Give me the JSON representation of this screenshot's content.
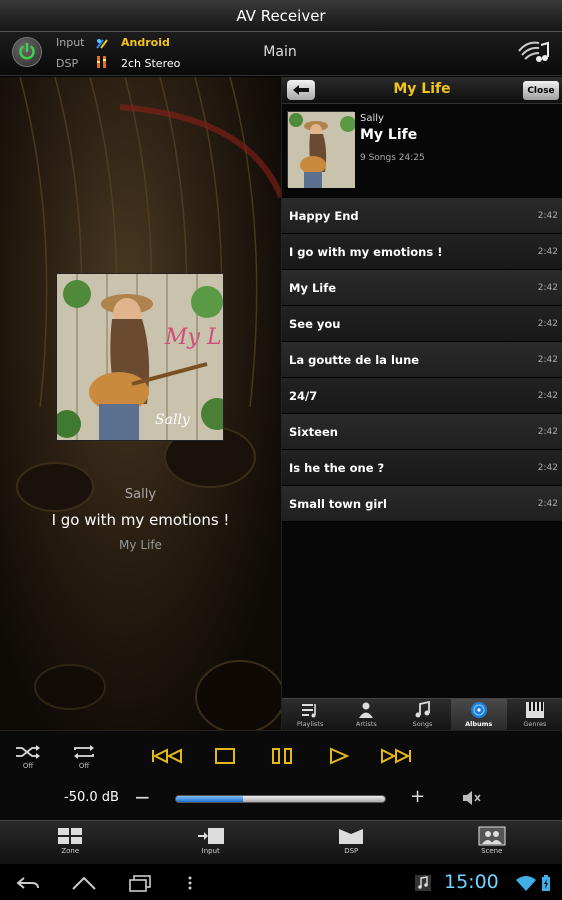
{
  "app": {
    "title": "AV Receiver"
  },
  "header": {
    "input_label": "Input",
    "input_value": "Android",
    "dsp_label": "DSP",
    "dsp_value": "2ch Stereo",
    "zone_label": "Main",
    "input_icon": "android-antenna-icon",
    "dsp_icon": "dsp-bars-icon",
    "network_icon": "network-music-icon",
    "accent_color": "#f2c41c"
  },
  "now_playing": {
    "artist": "Sally",
    "song": "I go with my emotions !",
    "album": "My Life",
    "art_text_title": "My Life",
    "art_text_artist": "Sally"
  },
  "browser": {
    "title": "My Life",
    "back_icon": "back-arrow-icon",
    "close_label": "Close",
    "album": {
      "artist": "Sally",
      "name": "My Life",
      "meta": "9 Songs  24:25"
    },
    "songs": [
      {
        "title": "Happy End",
        "duration": "2:42"
      },
      {
        "title": "I go with my emotions !",
        "duration": "2:42"
      },
      {
        "title": "My Life",
        "duration": "2:42"
      },
      {
        "title": "See you",
        "duration": "2:42"
      },
      {
        "title": "La goutte de la lune",
        "duration": "2:42"
      },
      {
        "title": "24/7",
        "duration": "2:42"
      },
      {
        "title": "Sixteen",
        "duration": "2:42"
      },
      {
        "title": "Is he the one ?",
        "duration": "2:42"
      },
      {
        "title": "Small town girl",
        "duration": "2:42"
      }
    ],
    "tabs": [
      {
        "label": "Playlists",
        "icon": "playlists-icon"
      },
      {
        "label": "Artists",
        "icon": "artists-icon"
      },
      {
        "label": "Songs",
        "icon": "songs-icon"
      },
      {
        "label": "Albums",
        "icon": "albums-icon",
        "active": true
      },
      {
        "label": "Genres",
        "icon": "genres-icon"
      }
    ]
  },
  "transport": {
    "shuffle_label": "Off",
    "repeat_label": "Off",
    "volume_label": "-50.0 dB",
    "volume_level": 0.32,
    "minus": "−",
    "plus": "+"
  },
  "function_tabs": [
    {
      "label": "Zone",
      "icon": "zone-icon"
    },
    {
      "label": "Input",
      "icon": "input-icon"
    },
    {
      "label": "DSP",
      "icon": "dsp-icon"
    },
    {
      "label": "Scene",
      "icon": "scene-icon"
    }
  ],
  "system": {
    "clock": "15:00"
  }
}
